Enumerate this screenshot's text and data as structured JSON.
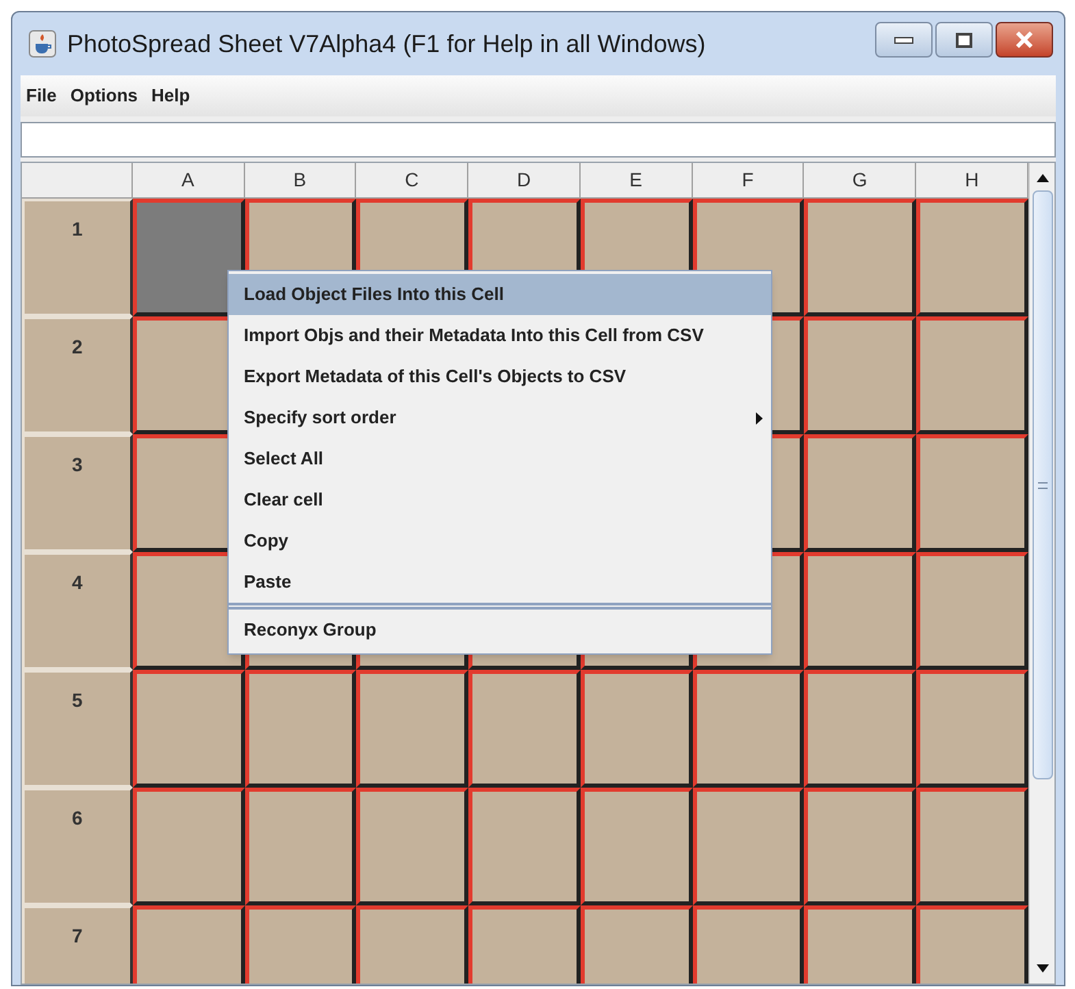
{
  "window": {
    "title": "PhotoSpread Sheet V7Alpha4  (F1 for Help in all Windows)"
  },
  "menu_bar": [
    "File",
    "Options",
    "Help"
  ],
  "columns": [
    "A",
    "B",
    "C",
    "D",
    "E",
    "F",
    "G",
    "H"
  ],
  "rows": [
    {
      "label": "1",
      "cells": [
        {
          "selected": true
        },
        {
          "selected": false
        },
        {
          "selected": false
        },
        {
          "selected": false
        },
        {
          "selected": false
        },
        {
          "selected": false
        },
        {
          "selected": false
        },
        {
          "selected": false
        }
      ]
    },
    {
      "label": "2",
      "cells": [
        {
          "selected": false
        },
        null,
        null,
        null,
        null,
        {
          "selected": false
        },
        {
          "selected": false
        },
        {
          "selected": false
        }
      ]
    },
    {
      "label": "3",
      "cells": [
        {
          "selected": false
        },
        null,
        null,
        null,
        null,
        {
          "selected": false
        },
        {
          "selected": false
        },
        {
          "selected": false
        }
      ]
    },
    {
      "label": "4",
      "cells": [
        {
          "selected": false
        },
        {
          "selected": false
        },
        {
          "selected": false
        },
        {
          "selected": false
        },
        {
          "selected": false
        },
        {
          "selected": false
        },
        {
          "selected": false
        },
        {
          "selected": false
        }
      ]
    },
    {
      "label": "5",
      "cells": [
        {
          "selected": false
        },
        {
          "selected": false
        },
        {
          "selected": false
        },
        {
          "selected": false
        },
        {
          "selected": false
        },
        {
          "selected": false
        },
        {
          "selected": false
        },
        {
          "selected": false
        }
      ]
    },
    {
      "label": "6",
      "cells": [
        {
          "selected": false
        },
        {
          "selected": false
        },
        {
          "selected": false
        },
        {
          "selected": false
        },
        {
          "selected": false
        },
        {
          "selected": false
        },
        {
          "selected": false
        },
        {
          "selected": false
        }
      ]
    },
    {
      "label": "7",
      "cells": [
        {
          "selected": false
        },
        {
          "selected": false
        },
        {
          "selected": false
        },
        {
          "selected": false
        },
        {
          "selected": false
        },
        {
          "selected": false
        },
        {
          "selected": false
        },
        {
          "selected": false
        }
      ]
    }
  ],
  "context_menu": [
    {
      "label": "Load Object Files Into this Cell",
      "selected": true,
      "submenu": false,
      "separator_before": false
    },
    {
      "label": "Import Objs and their Metadata Into this Cell from CSV",
      "selected": false,
      "submenu": false,
      "separator_before": false
    },
    {
      "label": "Export Metadata of this Cell's Objects to CSV",
      "selected": false,
      "submenu": false,
      "separator_before": false
    },
    {
      "label": "Specify sort order",
      "selected": false,
      "submenu": true,
      "separator_before": false
    },
    {
      "label": "Select All",
      "selected": false,
      "submenu": false,
      "separator_before": false
    },
    {
      "label": "Clear cell",
      "selected": false,
      "submenu": false,
      "separator_before": false
    },
    {
      "label": "Copy",
      "selected": false,
      "submenu": false,
      "separator_before": false
    },
    {
      "label": "Paste",
      "selected": false,
      "submenu": false,
      "separator_before": false
    },
    {
      "label": "Reconyx Group",
      "selected": false,
      "submenu": false,
      "separator_before": true
    }
  ]
}
